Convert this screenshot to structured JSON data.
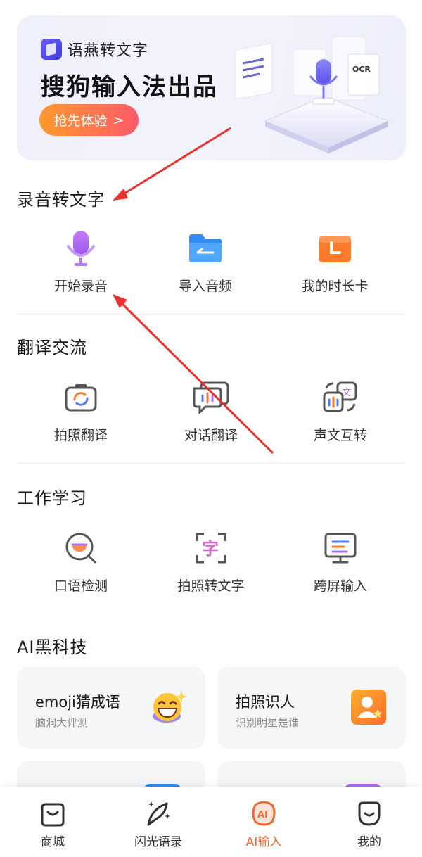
{
  "banner": {
    "brand": "语燕转文字",
    "title": "搜狗输入法出品",
    "cta": "抢先体验",
    "cta_chevron": ">",
    "ocr_label": "OCR"
  },
  "sections": {
    "recording": {
      "title": "录音转文字",
      "items": [
        {
          "label": "开始录音",
          "icon": "microphone-icon"
        },
        {
          "label": "导入音频",
          "icon": "folder-icon"
        },
        {
          "label": "我的时长卡",
          "icon": "clock-card-icon"
        }
      ]
    },
    "translate": {
      "title": "翻译交流",
      "items": [
        {
          "label": "拍照翻译",
          "icon": "camera-translate-icon"
        },
        {
          "label": "对话翻译",
          "icon": "chat-translate-icon"
        },
        {
          "label": "声文互转",
          "icon": "voice-text-icon"
        }
      ],
      "icon_glyph": "文"
    },
    "work": {
      "title": "工作学习",
      "items": [
        {
          "label": "口语检测",
          "icon": "speech-check-icon"
        },
        {
          "label": "拍照转文字",
          "icon": "scan-text-icon"
        },
        {
          "label": "跨屏输入",
          "icon": "monitor-icon"
        }
      ],
      "scan_glyph": "字"
    },
    "ai": {
      "title": "AI黑科技",
      "cards": [
        {
          "title": "emoji猜成语",
          "subtitle": "脑洞大评测",
          "icon": "emoji-icon"
        },
        {
          "title": "拍照识人",
          "subtitle": "识别明星是谁",
          "icon": "face-id-icon"
        }
      ]
    }
  },
  "bottom_nav": [
    {
      "label": "商城",
      "icon": "shopping-bag-icon",
      "active": false
    },
    {
      "label": "闪光语录",
      "icon": "feather-icon",
      "active": false
    },
    {
      "label": "AI输入",
      "icon": "ai-icon",
      "active": true
    },
    {
      "label": "我的",
      "icon": "profile-icon",
      "active": false
    }
  ],
  "ai_badge": "AI",
  "colors": {
    "accent_orange": "#f06a35",
    "cta_start": "#ff9a2e",
    "cta_end": "#ff5a6a",
    "mic_purple": "#b06cf0",
    "folder_blue": "#2f8cf5",
    "clock_orange": "#ff7a2a",
    "annotation_red": "#e8322c"
  }
}
